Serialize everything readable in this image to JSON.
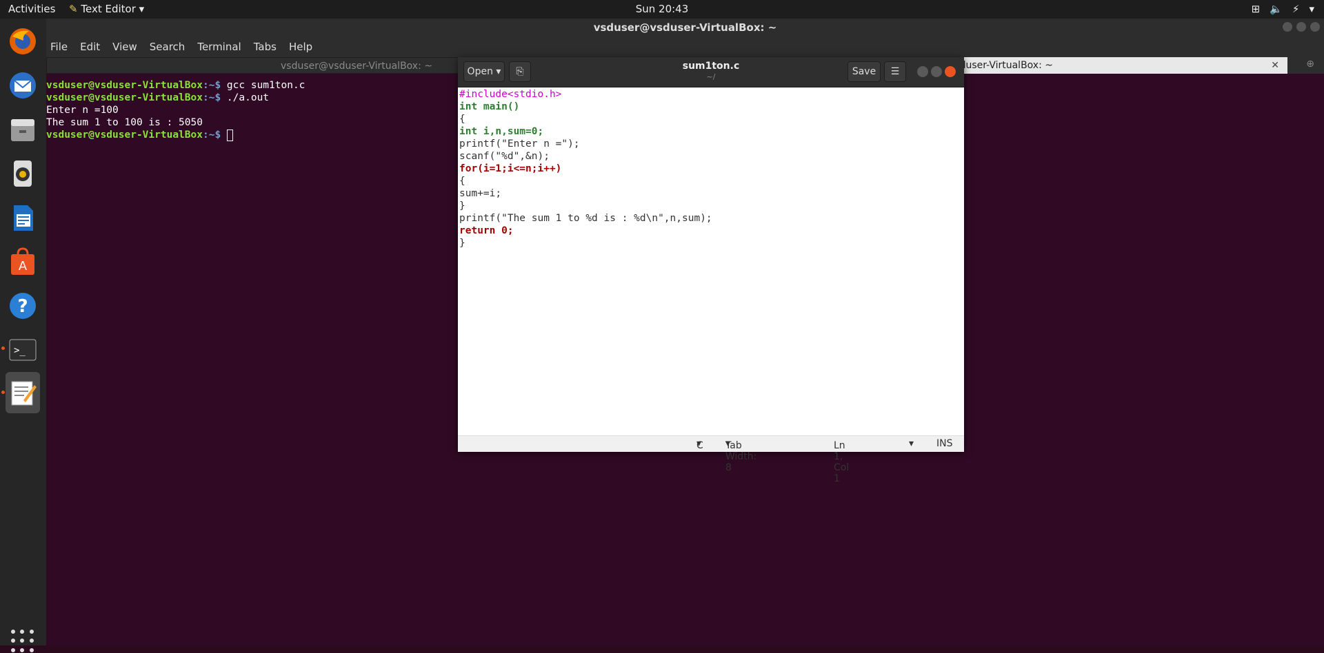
{
  "topbar": {
    "activities": "Activities",
    "app_menu": "Text Editor",
    "clock": "Sun 20:43"
  },
  "terminal": {
    "title": "vsduser@vsduser-VirtualBox: ~",
    "menu": [
      "File",
      "Edit",
      "View",
      "Search",
      "Terminal",
      "Tabs",
      "Help"
    ],
    "tabs": [
      "vsduser@vsduser-VirtualBox: ~",
      "vsduser@vsduser-VirtualBox: ~"
    ],
    "prompt_user": "vsduser@vsduser-VirtualBox",
    "prompt_sep": ":~$",
    "lines": [
      {
        "type": "prompt",
        "cmd": " gcc sum1ton.c"
      },
      {
        "type": "prompt",
        "cmd": " ./a.out"
      },
      {
        "type": "out",
        "text": "Enter n =100"
      },
      {
        "type": "out",
        "text": "The sum 1 to 100 is : 5050"
      },
      {
        "type": "prompt",
        "cmd": " "
      }
    ]
  },
  "gedit": {
    "open_label": "Open",
    "save_label": "Save",
    "title": "sum1ton.c",
    "subtitle": "~/",
    "status": {
      "language": "C",
      "tab_width": "Tab Width: 8",
      "position": "Ln 1, Col 1",
      "mode": "INS"
    },
    "code_lines": [
      "#include<stdio.h>",
      "int main()",
      "{",
      "int i,n,sum=0;",
      "printf(\"Enter n =\");",
      "scanf(\"%d\",&n);",
      "for(i=1;i<=n;i++)",
      "{",
      "sum+=i;",
      "}",
      "printf(\"The sum 1 to %d is : %d\\n\",n,sum);",
      "return 0;",
      "}"
    ]
  },
  "dock": {
    "items": [
      "firefox-icon",
      "thunderbird-icon",
      "files-icon",
      "rhythmbox-icon",
      "writer-icon",
      "software-icon",
      "help-icon",
      "terminal-icon",
      "text-editor-icon"
    ]
  }
}
